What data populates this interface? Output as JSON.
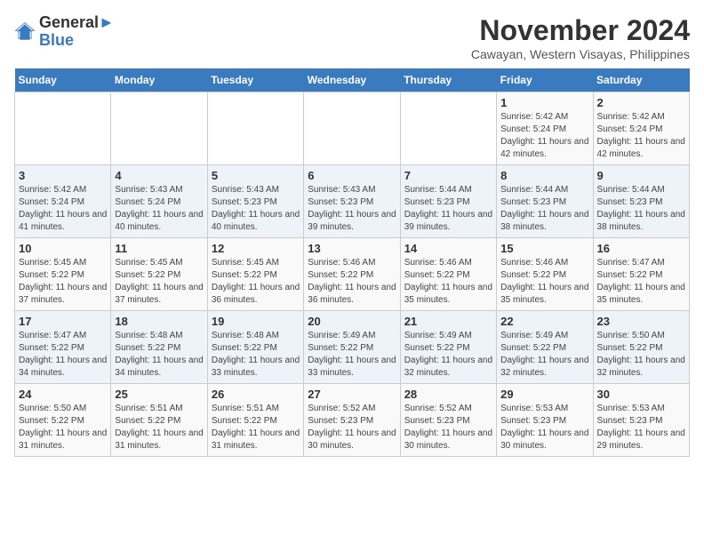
{
  "logo": {
    "line1": "General",
    "line2": "Blue"
  },
  "title": "November 2024",
  "subtitle": "Cawayan, Western Visayas, Philippines",
  "weekdays": [
    "Sunday",
    "Monday",
    "Tuesday",
    "Wednesday",
    "Thursday",
    "Friday",
    "Saturday"
  ],
  "weeks": [
    [
      {
        "day": "",
        "info": ""
      },
      {
        "day": "",
        "info": ""
      },
      {
        "day": "",
        "info": ""
      },
      {
        "day": "",
        "info": ""
      },
      {
        "day": "",
        "info": ""
      },
      {
        "day": "1",
        "info": "Sunrise: 5:42 AM\nSunset: 5:24 PM\nDaylight: 11 hours and 42 minutes."
      },
      {
        "day": "2",
        "info": "Sunrise: 5:42 AM\nSunset: 5:24 PM\nDaylight: 11 hours and 42 minutes."
      }
    ],
    [
      {
        "day": "3",
        "info": "Sunrise: 5:42 AM\nSunset: 5:24 PM\nDaylight: 11 hours and 41 minutes."
      },
      {
        "day": "4",
        "info": "Sunrise: 5:43 AM\nSunset: 5:24 PM\nDaylight: 11 hours and 40 minutes."
      },
      {
        "day": "5",
        "info": "Sunrise: 5:43 AM\nSunset: 5:23 PM\nDaylight: 11 hours and 40 minutes."
      },
      {
        "day": "6",
        "info": "Sunrise: 5:43 AM\nSunset: 5:23 PM\nDaylight: 11 hours and 39 minutes."
      },
      {
        "day": "7",
        "info": "Sunrise: 5:44 AM\nSunset: 5:23 PM\nDaylight: 11 hours and 39 minutes."
      },
      {
        "day": "8",
        "info": "Sunrise: 5:44 AM\nSunset: 5:23 PM\nDaylight: 11 hours and 38 minutes."
      },
      {
        "day": "9",
        "info": "Sunrise: 5:44 AM\nSunset: 5:23 PM\nDaylight: 11 hours and 38 minutes."
      }
    ],
    [
      {
        "day": "10",
        "info": "Sunrise: 5:45 AM\nSunset: 5:22 PM\nDaylight: 11 hours and 37 minutes."
      },
      {
        "day": "11",
        "info": "Sunrise: 5:45 AM\nSunset: 5:22 PM\nDaylight: 11 hours and 37 minutes."
      },
      {
        "day": "12",
        "info": "Sunrise: 5:45 AM\nSunset: 5:22 PM\nDaylight: 11 hours and 36 minutes."
      },
      {
        "day": "13",
        "info": "Sunrise: 5:46 AM\nSunset: 5:22 PM\nDaylight: 11 hours and 36 minutes."
      },
      {
        "day": "14",
        "info": "Sunrise: 5:46 AM\nSunset: 5:22 PM\nDaylight: 11 hours and 35 minutes."
      },
      {
        "day": "15",
        "info": "Sunrise: 5:46 AM\nSunset: 5:22 PM\nDaylight: 11 hours and 35 minutes."
      },
      {
        "day": "16",
        "info": "Sunrise: 5:47 AM\nSunset: 5:22 PM\nDaylight: 11 hours and 35 minutes."
      }
    ],
    [
      {
        "day": "17",
        "info": "Sunrise: 5:47 AM\nSunset: 5:22 PM\nDaylight: 11 hours and 34 minutes."
      },
      {
        "day": "18",
        "info": "Sunrise: 5:48 AM\nSunset: 5:22 PM\nDaylight: 11 hours and 34 minutes."
      },
      {
        "day": "19",
        "info": "Sunrise: 5:48 AM\nSunset: 5:22 PM\nDaylight: 11 hours and 33 minutes."
      },
      {
        "day": "20",
        "info": "Sunrise: 5:49 AM\nSunset: 5:22 PM\nDaylight: 11 hours and 33 minutes."
      },
      {
        "day": "21",
        "info": "Sunrise: 5:49 AM\nSunset: 5:22 PM\nDaylight: 11 hours and 32 minutes."
      },
      {
        "day": "22",
        "info": "Sunrise: 5:49 AM\nSunset: 5:22 PM\nDaylight: 11 hours and 32 minutes."
      },
      {
        "day": "23",
        "info": "Sunrise: 5:50 AM\nSunset: 5:22 PM\nDaylight: 11 hours and 32 minutes."
      }
    ],
    [
      {
        "day": "24",
        "info": "Sunrise: 5:50 AM\nSunset: 5:22 PM\nDaylight: 11 hours and 31 minutes."
      },
      {
        "day": "25",
        "info": "Sunrise: 5:51 AM\nSunset: 5:22 PM\nDaylight: 11 hours and 31 minutes."
      },
      {
        "day": "26",
        "info": "Sunrise: 5:51 AM\nSunset: 5:22 PM\nDaylight: 11 hours and 31 minutes."
      },
      {
        "day": "27",
        "info": "Sunrise: 5:52 AM\nSunset: 5:23 PM\nDaylight: 11 hours and 30 minutes."
      },
      {
        "day": "28",
        "info": "Sunrise: 5:52 AM\nSunset: 5:23 PM\nDaylight: 11 hours and 30 minutes."
      },
      {
        "day": "29",
        "info": "Sunrise: 5:53 AM\nSunset: 5:23 PM\nDaylight: 11 hours and 30 minutes."
      },
      {
        "day": "30",
        "info": "Sunrise: 5:53 AM\nSunset: 5:23 PM\nDaylight: 11 hours and 29 minutes."
      }
    ]
  ]
}
